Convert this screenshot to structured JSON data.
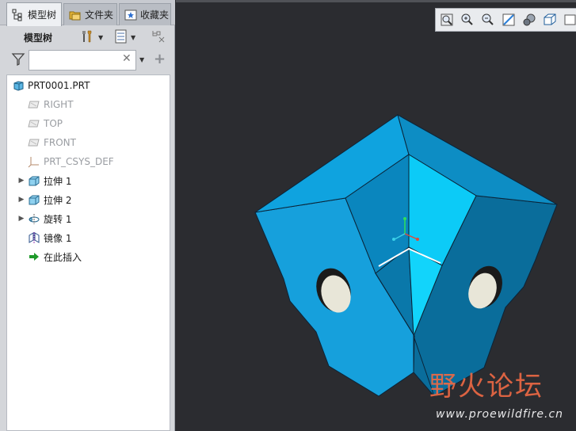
{
  "tabs": [
    {
      "label": "模型树",
      "icon": "model-tree-icon"
    },
    {
      "label": "文件夹",
      "icon": "folder-icon"
    },
    {
      "label": "收藏夹",
      "icon": "favorites-icon"
    }
  ],
  "toolbar": {
    "label": "模型树"
  },
  "filter": {
    "value": "",
    "placeholder": ""
  },
  "tree": {
    "root": "PRT0001.PRT",
    "items": [
      {
        "label": "RIGHT",
        "icon": "datum-plane-icon",
        "dim": true,
        "expandable": false
      },
      {
        "label": "TOP",
        "icon": "datum-plane-icon",
        "dim": true,
        "expandable": false
      },
      {
        "label": "FRONT",
        "icon": "datum-plane-icon",
        "dim": true,
        "expandable": false
      },
      {
        "label": "PRT_CSYS_DEF",
        "icon": "csys-icon",
        "dim": true,
        "expandable": false
      },
      {
        "label": "拉伸 1",
        "icon": "extrude-icon",
        "dim": false,
        "expandable": true
      },
      {
        "label": "拉伸 2",
        "icon": "extrude-icon",
        "dim": false,
        "expandable": true
      },
      {
        "label": "旋转 1",
        "icon": "revolve-icon",
        "dim": false,
        "expandable": true
      },
      {
        "label": "镜像 1",
        "icon": "mirror-icon",
        "dim": false,
        "expandable": false
      },
      {
        "label": "在此插入",
        "icon": "insert-arrow-icon",
        "dim": false,
        "expandable": false
      }
    ]
  },
  "watermark": {
    "title": "野火论坛",
    "url": "www.proewildfire.cn"
  },
  "colors": {
    "panel": "#d4d6da",
    "viewport": "#2b2c30",
    "model_light": "#14c3f3",
    "model_dark": "#066f9f"
  }
}
